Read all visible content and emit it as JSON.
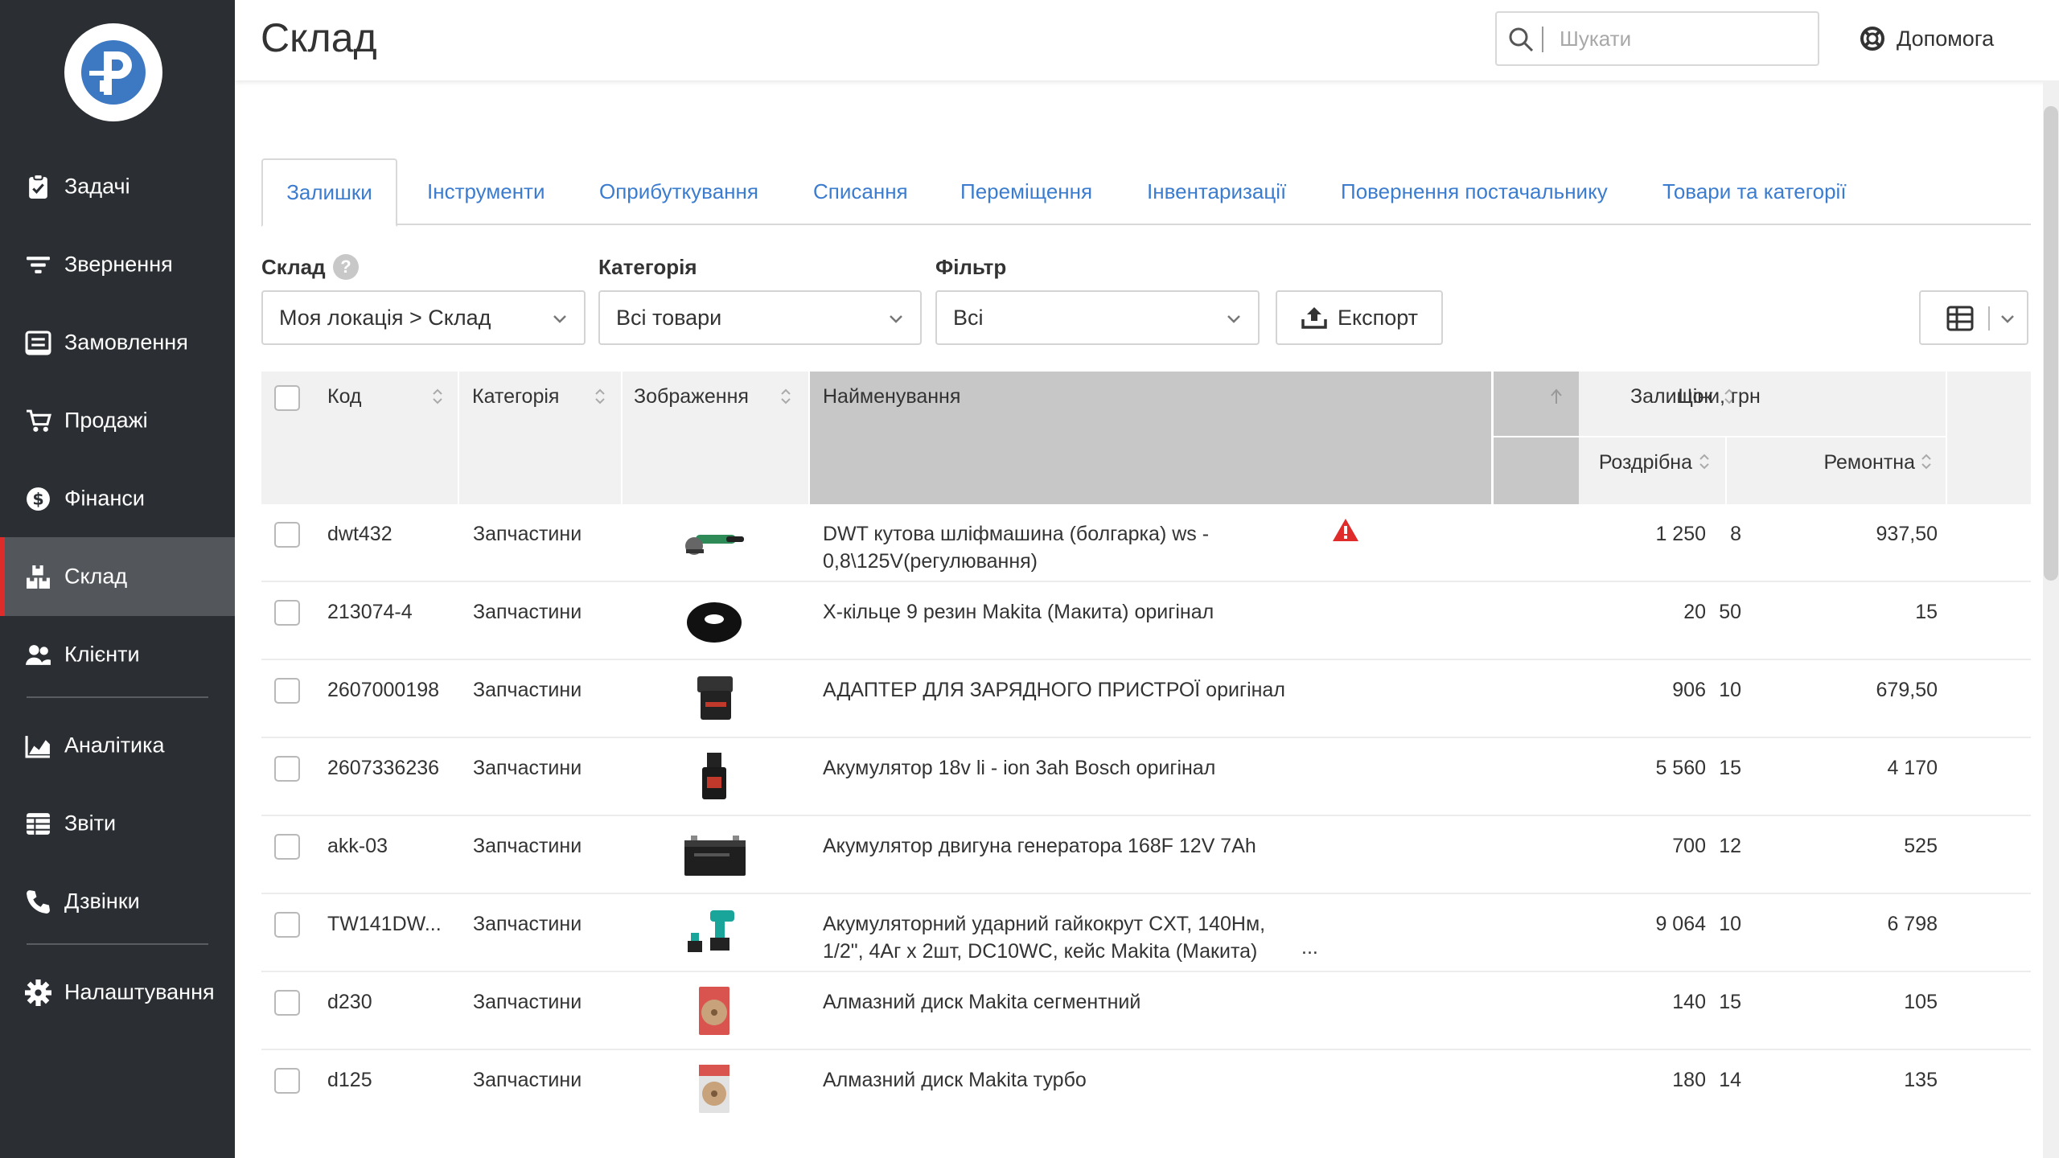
{
  "app": {
    "logo": "logo-p",
    "page_title": "Склад",
    "search": {
      "placeholder": "Шукати",
      "value": ""
    },
    "help_label": "Допомога"
  },
  "sidebar": {
    "items": [
      {
        "id": "tasks",
        "label": "Задачі",
        "icon": "clipboard-check-icon"
      },
      {
        "id": "requests",
        "label": "Звернення",
        "icon": "filter-lines-icon"
      },
      {
        "id": "orders",
        "label": "Замовлення",
        "icon": "order-list-icon"
      },
      {
        "id": "sales",
        "label": "Продажі",
        "icon": "cart-icon"
      },
      {
        "id": "finance",
        "label": "Фінанси",
        "icon": "dollar-circle-icon"
      },
      {
        "id": "warehouse",
        "label": "Склад",
        "icon": "boxes-icon",
        "active": true
      },
      {
        "id": "clients",
        "label": "Клієнти",
        "icon": "users-icon"
      },
      {
        "id": "analytics",
        "label": "Аналітика",
        "icon": "area-chart-icon"
      },
      {
        "id": "reports",
        "label": "Звіти",
        "icon": "table-list-icon"
      },
      {
        "id": "calls",
        "label": "Дзвінки",
        "icon": "phone-icon"
      },
      {
        "id": "settings",
        "label": "Налаштування",
        "icon": "gear-icon"
      }
    ]
  },
  "tabs": [
    {
      "label": "Залишки",
      "active": true
    },
    {
      "label": "Інструменти"
    },
    {
      "label": "Оприбуткування"
    },
    {
      "label": "Списання"
    },
    {
      "label": "Переміщення"
    },
    {
      "label": "Інвентаризації"
    },
    {
      "label": "Повернення постачальнику"
    },
    {
      "label": "Товари та категорії"
    }
  ],
  "filters": {
    "warehouse": {
      "label": "Склад",
      "help": "?",
      "value": "Моя локація > Склад"
    },
    "category": {
      "label": "Категорія",
      "value": "Всі товари"
    },
    "filter": {
      "label": "Фільтр",
      "value": "Всі"
    },
    "export_label": "Експорт"
  },
  "table": {
    "columns": {
      "code": "Код",
      "category": "Категорія",
      "image": "Зображення",
      "name": "Найменування",
      "stock": "Залишок",
      "prices": "Ціни, грн",
      "retail": "Роздрібна",
      "repair": "Ремонтна"
    },
    "rows": [
      {
        "code": "dwt432",
        "category": "Запчастини",
        "image": "angle-grinder",
        "name": "DWT кутова шліфмашина (болгарка) ws - 0,8\\125V(регулювання)",
        "stock": "8",
        "retail": "1 250",
        "repair": "937,50",
        "warning": true
      },
      {
        "code": "213074-4",
        "category": "Запчастини",
        "image": "rubber-o-ring",
        "name": "X-кільце 9 резин Makita (Макита) оригінал",
        "stock": "50",
        "retail": "20",
        "repair": "15"
      },
      {
        "code": "2607000198",
        "category": "Запчастини",
        "image": "charger-adapter",
        "name": "АДАПТЕР ДЛЯ ЗАРЯДНОГО ПРИСТРОЇ оригінал",
        "stock": "10",
        "retail": "906",
        "repair": "679,50"
      },
      {
        "code": "2607336236",
        "category": "Запчастини",
        "image": "battery-pack",
        "name": "Акумулятор 18v li - ion 3ah Bosch оригінал",
        "stock": "15",
        "retail": "5 560",
        "repair": "4 170"
      },
      {
        "code": "akk-03",
        "category": "Запчастини",
        "image": "generator-battery",
        "name": "Акумулятор двигуна генератора 168F 12V 7Ah",
        "stock": "12",
        "retail": "700",
        "repair": "525"
      },
      {
        "code": "TW141DW...",
        "category": "Запчастини",
        "image": "impact-wrench",
        "name": "Акумуляторний ударний гайкокрут CXT, 140Нм, 1/2\", 4Аг x 2шт, DC10WC, кейс Makita (Макита)",
        "stock": "10",
        "retail": "9 064",
        "repair": "6 798",
        "ellipsis": "..."
      },
      {
        "code": "d230",
        "category": "Запчастини",
        "image": "diamond-disc-segment",
        "name": "Алмазний диск Makita сегментний",
        "stock": "15",
        "retail": "140",
        "repair": "105"
      },
      {
        "code": "d125",
        "category": "Запчастини",
        "image": "diamond-disc-turbo",
        "name": "Алмазний диск Makita турбо",
        "stock": "14",
        "retail": "180",
        "repair": "135"
      }
    ]
  },
  "colors": {
    "sidebar_bg": "#2b2f33",
    "sidebar_active": "#53575c",
    "active_marker": "#e02b2b",
    "link_blue": "#3b7ccf",
    "header_gray": "#f1f1f1",
    "sorted_col": "#c7c7c7",
    "warning_red": "#e02b2b",
    "logo_blue": "#3d78c2"
  }
}
